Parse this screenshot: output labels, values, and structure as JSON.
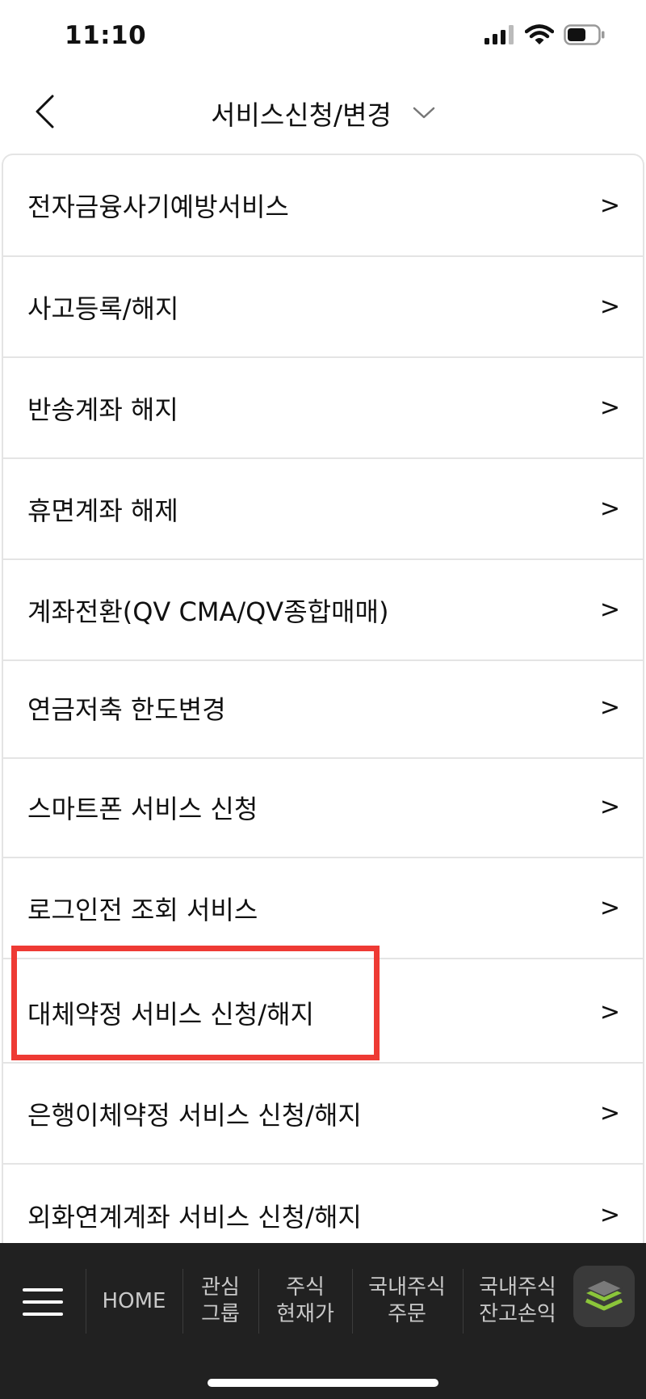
{
  "status": {
    "time": "11:10"
  },
  "header": {
    "title": "서비스신청/변경"
  },
  "list": {
    "items": [
      {
        "label": "전자금융사기예방서비스",
        "arrow": ">"
      },
      {
        "label": "사고등록/해지",
        "arrow": ">"
      },
      {
        "label": "반송계좌 해지",
        "arrow": ">"
      },
      {
        "label": "휴면계좌 해제",
        "arrow": ">"
      },
      {
        "label": "계좌전환(QV CMA/QV종합매매)",
        "arrow": ">"
      },
      {
        "label": "연금저축 한도변경",
        "arrow": ">"
      },
      {
        "label": "스마트폰 서비스 신청",
        "arrow": ">"
      },
      {
        "label": "로그인전 조회 서비스",
        "arrow": ">"
      },
      {
        "label": "대체약정 서비스 신청/해지",
        "arrow": ">"
      },
      {
        "label": "은행이체약정 서비스 신청/해지",
        "arrow": ">"
      },
      {
        "label": "외화연계계좌 서비스 신청/해지",
        "arrow": ">"
      }
    ]
  },
  "bottom_nav": {
    "items": [
      {
        "label": "HOME"
      },
      {
        "label": "관심\n그룹"
      },
      {
        "label": "주식\n현재가"
      },
      {
        "label": "국내주식\n주문"
      },
      {
        "label": "국내주식\n잔고손익"
      }
    ]
  },
  "colors": {
    "highlight": "#ee3a34",
    "bottom_bar": "#212121",
    "layers_accent": "#9bd13a"
  }
}
